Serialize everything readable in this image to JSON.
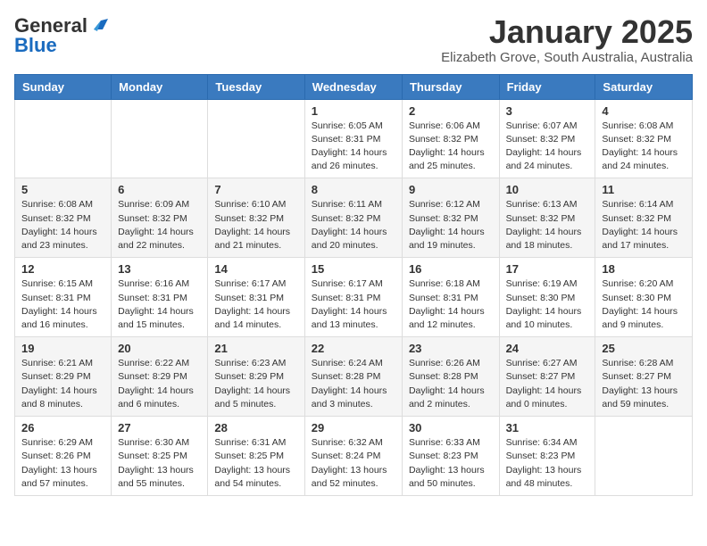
{
  "header": {
    "logo_general": "General",
    "logo_blue": "Blue",
    "month": "January 2025",
    "location": "Elizabeth Grove, South Australia, Australia"
  },
  "days_of_week": [
    "Sunday",
    "Monday",
    "Tuesday",
    "Wednesday",
    "Thursday",
    "Friday",
    "Saturday"
  ],
  "weeks": [
    [
      {
        "day": "",
        "info": ""
      },
      {
        "day": "",
        "info": ""
      },
      {
        "day": "",
        "info": ""
      },
      {
        "day": "1",
        "info": "Sunrise: 6:05 AM\nSunset: 8:31 PM\nDaylight: 14 hours\nand 26 minutes."
      },
      {
        "day": "2",
        "info": "Sunrise: 6:06 AM\nSunset: 8:32 PM\nDaylight: 14 hours\nand 25 minutes."
      },
      {
        "day": "3",
        "info": "Sunrise: 6:07 AM\nSunset: 8:32 PM\nDaylight: 14 hours\nand 24 minutes."
      },
      {
        "day": "4",
        "info": "Sunrise: 6:08 AM\nSunset: 8:32 PM\nDaylight: 14 hours\nand 24 minutes."
      }
    ],
    [
      {
        "day": "5",
        "info": "Sunrise: 6:08 AM\nSunset: 8:32 PM\nDaylight: 14 hours\nand 23 minutes."
      },
      {
        "day": "6",
        "info": "Sunrise: 6:09 AM\nSunset: 8:32 PM\nDaylight: 14 hours\nand 22 minutes."
      },
      {
        "day": "7",
        "info": "Sunrise: 6:10 AM\nSunset: 8:32 PM\nDaylight: 14 hours\nand 21 minutes."
      },
      {
        "day": "8",
        "info": "Sunrise: 6:11 AM\nSunset: 8:32 PM\nDaylight: 14 hours\nand 20 minutes."
      },
      {
        "day": "9",
        "info": "Sunrise: 6:12 AM\nSunset: 8:32 PM\nDaylight: 14 hours\nand 19 minutes."
      },
      {
        "day": "10",
        "info": "Sunrise: 6:13 AM\nSunset: 8:32 PM\nDaylight: 14 hours\nand 18 minutes."
      },
      {
        "day": "11",
        "info": "Sunrise: 6:14 AM\nSunset: 8:32 PM\nDaylight: 14 hours\nand 17 minutes."
      }
    ],
    [
      {
        "day": "12",
        "info": "Sunrise: 6:15 AM\nSunset: 8:31 PM\nDaylight: 14 hours\nand 16 minutes."
      },
      {
        "day": "13",
        "info": "Sunrise: 6:16 AM\nSunset: 8:31 PM\nDaylight: 14 hours\nand 15 minutes."
      },
      {
        "day": "14",
        "info": "Sunrise: 6:17 AM\nSunset: 8:31 PM\nDaylight: 14 hours\nand 14 minutes."
      },
      {
        "day": "15",
        "info": "Sunrise: 6:17 AM\nSunset: 8:31 PM\nDaylight: 14 hours\nand 13 minutes."
      },
      {
        "day": "16",
        "info": "Sunrise: 6:18 AM\nSunset: 8:31 PM\nDaylight: 14 hours\nand 12 minutes."
      },
      {
        "day": "17",
        "info": "Sunrise: 6:19 AM\nSunset: 8:30 PM\nDaylight: 14 hours\nand 10 minutes."
      },
      {
        "day": "18",
        "info": "Sunrise: 6:20 AM\nSunset: 8:30 PM\nDaylight: 14 hours\nand 9 minutes."
      }
    ],
    [
      {
        "day": "19",
        "info": "Sunrise: 6:21 AM\nSunset: 8:29 PM\nDaylight: 14 hours\nand 8 minutes."
      },
      {
        "day": "20",
        "info": "Sunrise: 6:22 AM\nSunset: 8:29 PM\nDaylight: 14 hours\nand 6 minutes."
      },
      {
        "day": "21",
        "info": "Sunrise: 6:23 AM\nSunset: 8:29 PM\nDaylight: 14 hours\nand 5 minutes."
      },
      {
        "day": "22",
        "info": "Sunrise: 6:24 AM\nSunset: 8:28 PM\nDaylight: 14 hours\nand 3 minutes."
      },
      {
        "day": "23",
        "info": "Sunrise: 6:26 AM\nSunset: 8:28 PM\nDaylight: 14 hours\nand 2 minutes."
      },
      {
        "day": "24",
        "info": "Sunrise: 6:27 AM\nSunset: 8:27 PM\nDaylight: 14 hours\nand 0 minutes."
      },
      {
        "day": "25",
        "info": "Sunrise: 6:28 AM\nSunset: 8:27 PM\nDaylight: 13 hours\nand 59 minutes."
      }
    ],
    [
      {
        "day": "26",
        "info": "Sunrise: 6:29 AM\nSunset: 8:26 PM\nDaylight: 13 hours\nand 57 minutes."
      },
      {
        "day": "27",
        "info": "Sunrise: 6:30 AM\nSunset: 8:25 PM\nDaylight: 13 hours\nand 55 minutes."
      },
      {
        "day": "28",
        "info": "Sunrise: 6:31 AM\nSunset: 8:25 PM\nDaylight: 13 hours\nand 54 minutes."
      },
      {
        "day": "29",
        "info": "Sunrise: 6:32 AM\nSunset: 8:24 PM\nDaylight: 13 hours\nand 52 minutes."
      },
      {
        "day": "30",
        "info": "Sunrise: 6:33 AM\nSunset: 8:23 PM\nDaylight: 13 hours\nand 50 minutes."
      },
      {
        "day": "31",
        "info": "Sunrise: 6:34 AM\nSunset: 8:23 PM\nDaylight: 13 hours\nand 48 minutes."
      },
      {
        "day": "",
        "info": ""
      }
    ]
  ]
}
